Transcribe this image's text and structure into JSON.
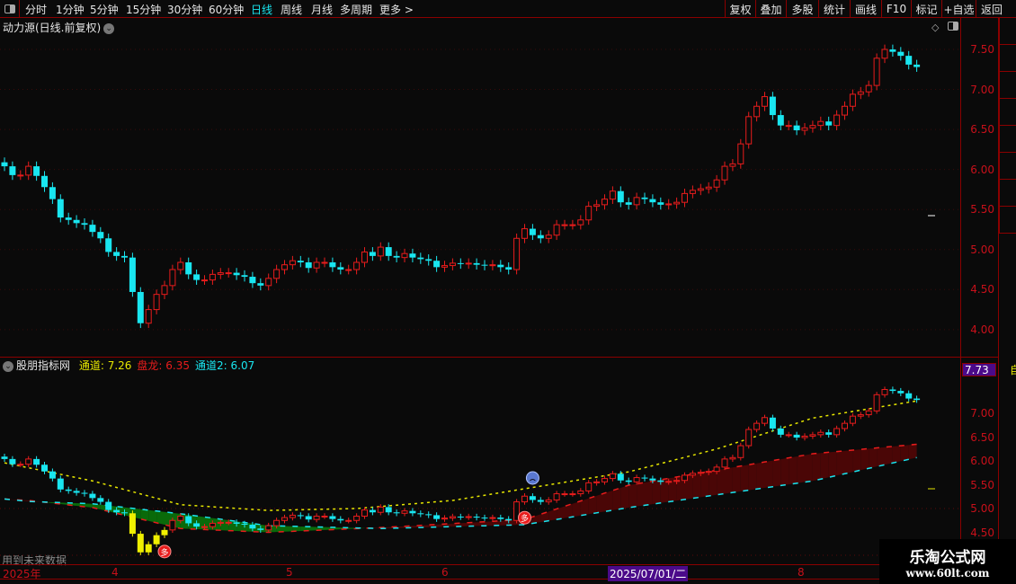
{
  "toolbar": {
    "periods": [
      "分时",
      "1分钟",
      "5分钟",
      "15分钟",
      "30分钟",
      "60分钟",
      "日线",
      "周线",
      "月线",
      "多周期",
      "更多 >"
    ],
    "active_period": "日线",
    "buttons": [
      "复权",
      "叠加",
      "多股",
      "统计",
      "画线",
      "F10",
      "标记",
      "+自选",
      "返回"
    ]
  },
  "main": {
    "title": "动力源(日线.前复权)",
    "expand_icon": "chevron-down-icon"
  },
  "price_axis": {
    "ticks": [
      "7.50",
      "7.00",
      "6.50",
      "6.00",
      "5.50",
      "5.00",
      "4.50",
      "4.00"
    ],
    "range": [
      3.85,
      7.85
    ]
  },
  "indicator": {
    "name": "股朋指标网",
    "items": [
      {
        "label": "通道: 7.26",
        "color": "#e6e600"
      },
      {
        "label": "盘龙: 6.35",
        "color": "#e81c1c"
      },
      {
        "label": "通道2: 6.07",
        "color": "#19e6f0"
      }
    ],
    "axis_ticks": [
      "7.00",
      "6.50",
      "6.00",
      "5.50",
      "5.00",
      "4.50"
    ],
    "price_tag": "7.73",
    "side_tag": "自",
    "note": "用到未来数据"
  },
  "time_axis": {
    "labels": [
      "2025年",
      "4",
      "5",
      "6",
      "2025/07/01/二",
      "8"
    ],
    "highlight": "2025/07/01/二"
  },
  "watermark": {
    "line1": "乐淘公式网",
    "line2": "www.60lt.com"
  },
  "chart_data": {
    "type": "candlestick",
    "up_color": "#e81c1c",
    "down_color": "#19e6f0",
    "closes": [
      6.04,
      5.93,
      5.93,
      6.04,
      5.92,
      5.78,
      5.63,
      5.4,
      5.37,
      5.33,
      5.31,
      5.22,
      5.14,
      4.97,
      4.92,
      4.9,
      4.47,
      4.08,
      4.25,
      4.44,
      4.55,
      4.75,
      4.84,
      4.69,
      4.62,
      4.62,
      4.69,
      4.71,
      4.71,
      4.68,
      4.66,
      4.58,
      4.55,
      4.64,
      4.75,
      4.81,
      4.86,
      4.84,
      4.77,
      4.84,
      4.84,
      4.78,
      4.75,
      4.75,
      4.84,
      4.97,
      4.92,
      5.03,
      4.92,
      4.9,
      4.95,
      4.9,
      4.88,
      4.86,
      4.78,
      4.8,
      4.83,
      4.82,
      4.83,
      4.81,
      4.8,
      4.81,
      4.78,
      4.75,
      5.14,
      5.26,
      5.18,
      5.14,
      5.18,
      5.31,
      5.31,
      5.31,
      5.37,
      5.54,
      5.56,
      5.63,
      5.73,
      5.59,
      5.56,
      5.65,
      5.63,
      5.59,
      5.56,
      5.57,
      5.59,
      5.7,
      5.74,
      5.76,
      5.78,
      5.87,
      6.04,
      6.07,
      6.32,
      6.66,
      6.79,
      6.91,
      6.68,
      6.55,
      6.55,
      6.49,
      6.52,
      6.55,
      6.6,
      6.55,
      6.68,
      6.79,
      6.94,
      6.97,
      7.05,
      7.39,
      7.5,
      7.47,
      7.42,
      7.31,
      7.28
    ],
    "highlighted_bars": [
      16,
      17,
      18,
      19,
      20
    ],
    "lines": [
      {
        "name": "通道",
        "color": "#e6e600",
        "style": "dashed",
        "points": [
          [
            0,
            5.96
          ],
          [
            11,
            5.58
          ],
          [
            22,
            5.08
          ],
          [
            33,
            4.96
          ],
          [
            44,
            5.0
          ],
          [
            56,
            5.17
          ],
          [
            67,
            5.47
          ],
          [
            78,
            5.77
          ],
          [
            89,
            6.25
          ],
          [
            101,
            6.9
          ],
          [
            114,
            7.26
          ]
        ]
      },
      {
        "name": "盘龙",
        "color": "#e81c1c",
        "style": "solid",
        "points": [
          [
            0,
            5.2
          ],
          [
            3,
            5.17
          ],
          [
            11,
            5.02
          ],
          [
            22,
            4.58
          ],
          [
            33,
            4.5
          ],
          [
            47,
            4.6
          ],
          [
            65,
            4.77
          ],
          [
            78,
            5.49
          ],
          [
            101,
            6.15
          ],
          [
            114,
            6.35
          ]
        ]
      },
      {
        "name": "通道2",
        "color": "#19e6f0",
        "style": "solid",
        "points": [
          [
            0,
            5.2
          ],
          [
            3,
            5.15
          ],
          [
            11,
            5.1
          ],
          [
            22,
            4.89
          ],
          [
            33,
            4.64
          ],
          [
            47,
            4.58
          ],
          [
            65,
            4.66
          ],
          [
            78,
            5.02
          ],
          [
            101,
            5.58
          ],
          [
            114,
            6.07
          ]
        ]
      }
    ],
    "signals": [
      {
        "bar": 20,
        "type": "buy-badge",
        "label": "多"
      },
      {
        "bar": 65,
        "type": "buy-badge",
        "label": "多"
      },
      {
        "bar": 66,
        "type": "sad-face"
      }
    ]
  }
}
